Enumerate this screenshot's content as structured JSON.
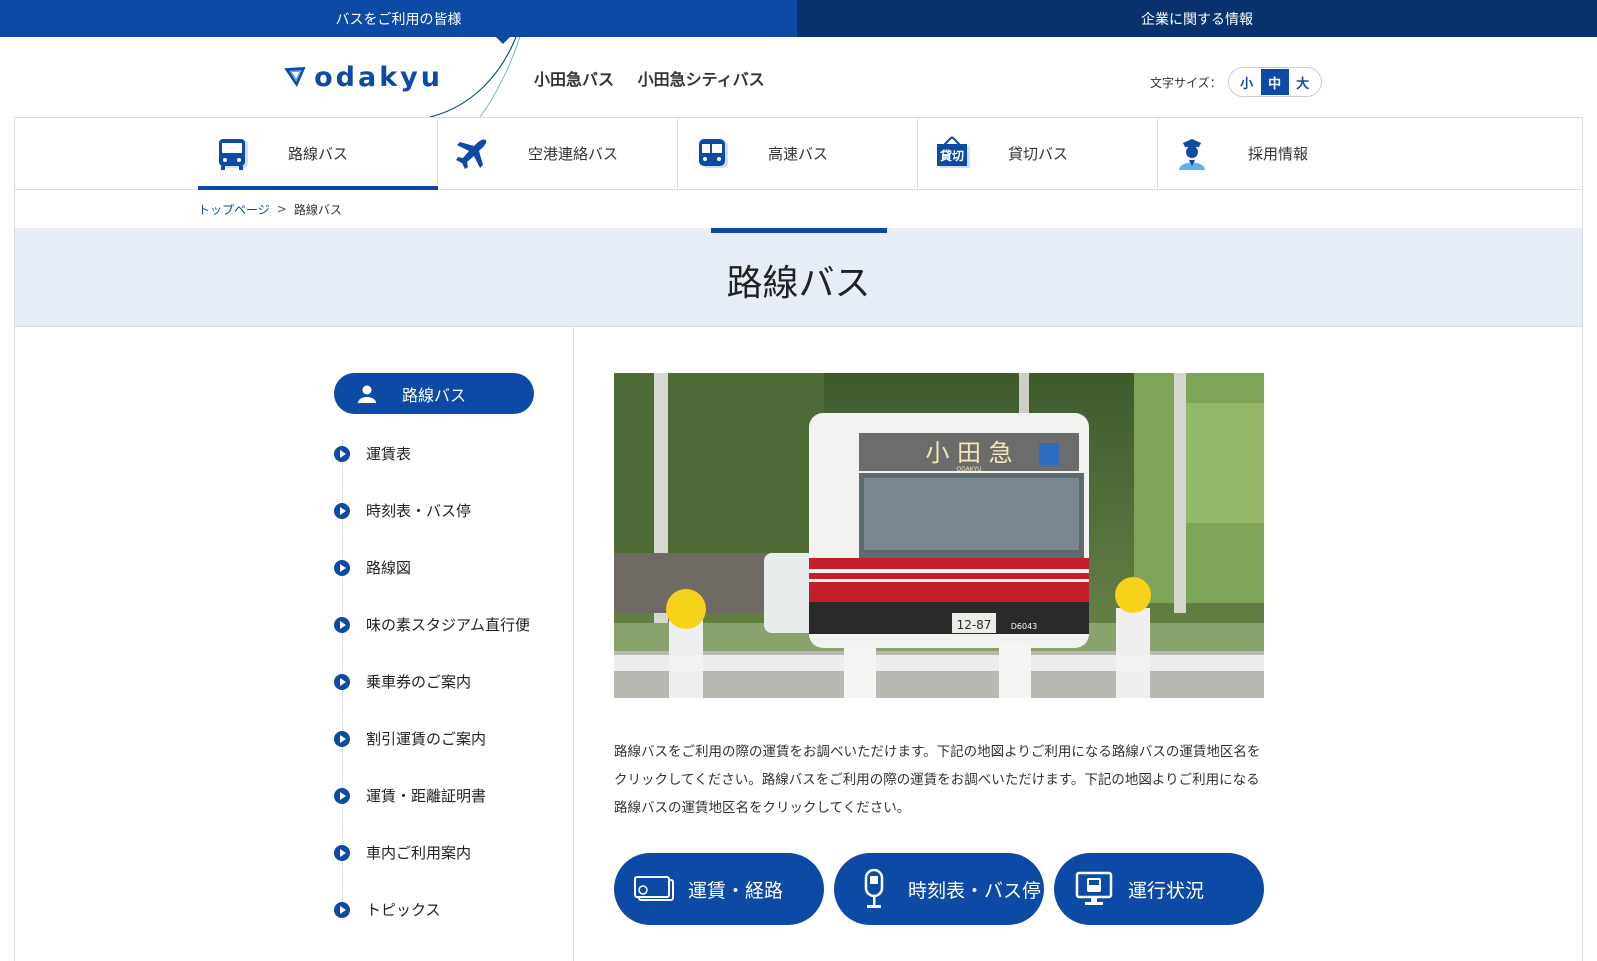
{
  "topbar": {
    "users_tab": "バスをご利用の皆様",
    "corporate_tab": "企業に関する情報"
  },
  "header": {
    "logo_text": "odakyu",
    "brands": [
      "小田急バス",
      "小田急シティバス"
    ],
    "font_size_label": "文字サイズ：",
    "font_sizes": [
      "小",
      "中",
      "大"
    ],
    "font_size_selected": "中"
  },
  "nav": {
    "items": [
      {
        "label": "路線バス",
        "icon": "bus-icon",
        "active": true
      },
      {
        "label": "空港連絡バス",
        "icon": "airplane-icon",
        "active": false
      },
      {
        "label": "高速バス",
        "icon": "highway-bus-icon",
        "active": false
      },
      {
        "label": "貸切バス",
        "icon": "charter-sign-icon",
        "active": false,
        "icon_text": "貸切"
      },
      {
        "label": "採用情報",
        "icon": "staff-icon",
        "active": false
      }
    ]
  },
  "breadcrumb": {
    "home": "トップページ",
    "separator": ">",
    "current": "路線バス"
  },
  "page": {
    "title": "路線バス"
  },
  "sidebar": {
    "header": "路線バス",
    "items": [
      "運賃表",
      "時刻表・バス停",
      "路線図",
      "味の素スタジアム直行便",
      "乗車券のご案内",
      "割引運賃のご案内",
      "運賃・距離証明書",
      "車内ご利用案内",
      "トピックス"
    ]
  },
  "main": {
    "photo": {
      "destination_sign": "小 田 急",
      "sub_sign": "ODAKYU",
      "plate": "12-87",
      "fleet_no": "D6043"
    },
    "description": "路線バスをご利用の際の運賃をお調べいただけます。下記の地図よりご利用になる路線バスの運賃地区名をクリックしてください。路線バスをご利用の際の運賃をお調べいただけます。下記の地図よりご利用になる路線バスの運賃地区名をクリックしてください。",
    "buttons": [
      {
        "label": "運賃・経路",
        "icon": "ticket-icon"
      },
      {
        "label": "時刻表・バス停",
        "icon": "bus-stop-icon"
      },
      {
        "label": "運行状況",
        "icon": "monitor-bus-icon"
      }
    ]
  },
  "colors": {
    "primary": "#0d4aa6",
    "dark": "#07326e",
    "band": "#e8eef7"
  }
}
